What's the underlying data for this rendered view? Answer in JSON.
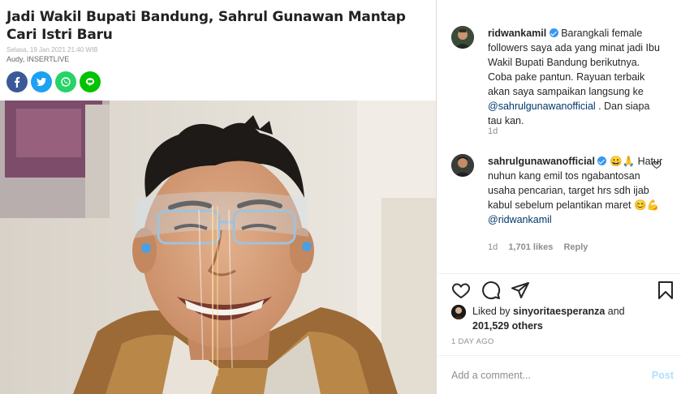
{
  "article": {
    "title": "Jadi Wakil Bupati Bandung, Sahrul Gunawan Mantap Cari Istri Baru",
    "date": "Selasa, 19 Jan 2021 21:40 WIB",
    "author": "Audy, INSERTLIVE",
    "share_buttons": [
      {
        "name": "facebook",
        "color": "#3b5998"
      },
      {
        "name": "twitter",
        "color": "#1da1f2"
      },
      {
        "name": "whatsapp",
        "color": "#25d366"
      },
      {
        "name": "line",
        "color": "#00c300"
      }
    ]
  },
  "comments": [
    {
      "username": "ridwankamil",
      "verified": true,
      "text": "Barangkali female followers saya ada yang minat jadi Ibu Wakil Bupati Bandung berikutnya. Coba pake pantun. Rayuan terbaik akan saya sampaikan langsung ke",
      "mention": "@sahrulgunawanofficial",
      "text_after": ". Dan siapa tau kan.",
      "time": "1d"
    },
    {
      "username": "sahrulgunawanofficial",
      "verified": true,
      "emoji_after_name": "😀🙏",
      "text": "Hatur nuhun kang emil tos ngabantosan usaha pencarian, target hrs sdh ijab kabul sebelum pelantikan maret 😊💪",
      "mention": "@ridwankamil",
      "time": "1d",
      "likes": "1,701 likes",
      "reply": "Reply"
    }
  ],
  "likes": {
    "prefix": "Liked by ",
    "user": "sinyoritaesperanza",
    "and": " and",
    "count": "201,529 others"
  },
  "time_ago": "1 DAY AGO",
  "add_comment": {
    "placeholder": "Add a comment...",
    "post_label": "Post"
  },
  "colors": {
    "verified": "#3897f0",
    "mention": "#00376b",
    "post_disabled": "#b2dffc"
  }
}
